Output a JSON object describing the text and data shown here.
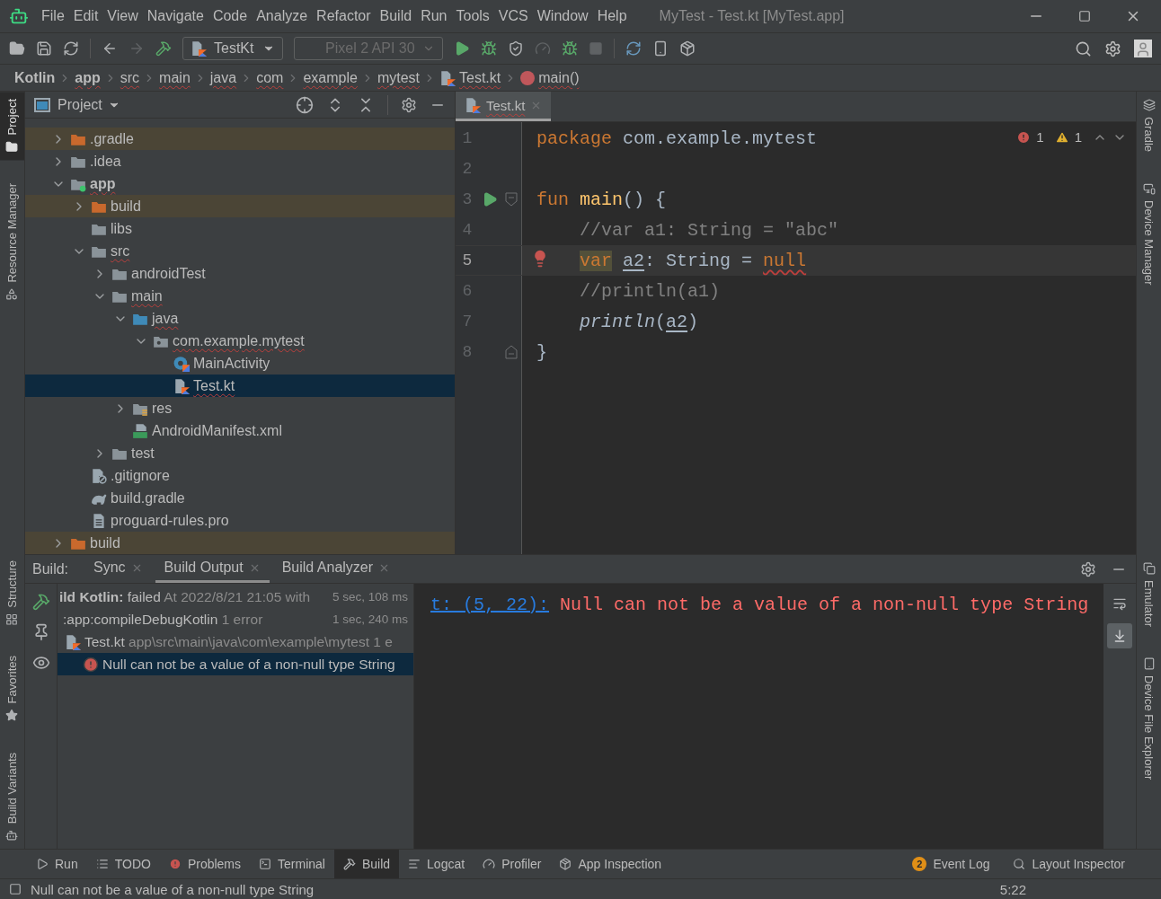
{
  "window": {
    "title": "MyTest - Test.kt [MyTest.app]"
  },
  "menu": [
    "File",
    "Edit",
    "View",
    "Navigate",
    "Code",
    "Analyze",
    "Refactor",
    "Build",
    "Run",
    "Tools",
    "VCS",
    "Window",
    "Help"
  ],
  "toolbar": {
    "run_config": "TestKt",
    "device": {
      "label": "Pixel 2 API 30",
      "disabled": true
    }
  },
  "breadcrumbs": [
    {
      "label": "Kotlin",
      "kind": "project",
      "error": false
    },
    {
      "label": "app",
      "kind": "module",
      "error": true
    },
    {
      "label": "src",
      "kind": "folder",
      "error": true
    },
    {
      "label": "main",
      "kind": "folder",
      "error": true
    },
    {
      "label": "java",
      "kind": "folder",
      "error": true
    },
    {
      "label": "com",
      "kind": "folder",
      "error": true
    },
    {
      "label": "example",
      "kind": "folder",
      "error": true
    },
    {
      "label": "mytest",
      "kind": "folder",
      "error": true
    },
    {
      "label": "Test.kt",
      "kind": "file",
      "error": true
    },
    {
      "label": "main()",
      "kind": "function",
      "error": true
    }
  ],
  "left_stripe": {
    "top": [
      {
        "label": "Project",
        "selected": true
      },
      {
        "label": "Resource Manager",
        "selected": false
      }
    ],
    "bottom": [
      {
        "label": "Structure",
        "selected": false
      },
      {
        "label": "Favorites",
        "selected": false
      },
      {
        "label": "Build Variants",
        "selected": false
      }
    ]
  },
  "right_stripe": {
    "top": [
      "Gradle",
      "Device Manager"
    ],
    "bottom": [
      "Emulator",
      "Device File Explorer"
    ]
  },
  "project_panel": {
    "title": "Project",
    "tree": [
      {
        "label": ".gradle",
        "kind": "folder-excluded",
        "expanded": false,
        "selected": false,
        "excluded": true,
        "error": false
      },
      {
        "label": ".idea",
        "kind": "folder",
        "expanded": false,
        "selected": false,
        "excluded": false,
        "error": false
      },
      {
        "label": "app",
        "kind": "module",
        "expanded": true,
        "selected": false,
        "excluded": false,
        "error": true,
        "children": [
          {
            "label": "build",
            "kind": "folder-excluded",
            "expanded": false,
            "selected": false,
            "excluded": true,
            "error": false
          },
          {
            "label": "libs",
            "kind": "folder",
            "selected": false,
            "excluded": false,
            "error": false
          },
          {
            "label": "src",
            "kind": "folder",
            "expanded": true,
            "selected": false,
            "excluded": false,
            "error": true,
            "children": [
              {
                "label": "androidTest",
                "kind": "folder",
                "expanded": false,
                "selected": false,
                "excluded": false,
                "error": false
              },
              {
                "label": "main",
                "kind": "folder",
                "expanded": true,
                "selected": false,
                "excluded": false,
                "error": true,
                "children": [
                  {
                    "label": "java",
                    "kind": "folder-source",
                    "expanded": true,
                    "selected": false,
                    "excluded": false,
                    "error": true,
                    "children": [
                      {
                        "label": "com.example.mytest",
                        "kind": "package",
                        "expanded": true,
                        "selected": false,
                        "excluded": false,
                        "error": true,
                        "children": [
                          {
                            "label": "MainActivity",
                            "kind": "activity",
                            "selected": false,
                            "excluded": false,
                            "error": false
                          },
                          {
                            "label": "Test.kt",
                            "kind": "kotlin-file",
                            "selected": true,
                            "excluded": false,
                            "error": true
                          }
                        ]
                      }
                    ]
                  },
                  {
                    "label": "res",
                    "kind": "res-folder",
                    "expanded": false,
                    "selected": false,
                    "excluded": false,
                    "error": false
                  },
                  {
                    "label": "AndroidManifest.xml",
                    "kind": "manifest",
                    "selected": false,
                    "excluded": false,
                    "error": false
                  }
                ]
              },
              {
                "label": "test",
                "kind": "folder",
                "expanded": false,
                "selected": false,
                "excluded": false,
                "error": false
              }
            ]
          },
          {
            "label": ".gitignore",
            "kind": "gitignore",
            "selected": false,
            "excluded": false,
            "error": false
          },
          {
            "label": "build.gradle",
            "kind": "gradle",
            "selected": false,
            "excluded": false,
            "error": false
          },
          {
            "label": "proguard-rules.pro",
            "kind": "text-file",
            "selected": false,
            "excluded": false,
            "error": false
          }
        ]
      },
      {
        "label": "build",
        "kind": "folder-excluded",
        "expanded": false,
        "selected": false,
        "excluded": true,
        "error": false
      }
    ]
  },
  "editor": {
    "tab": {
      "label": "Test.kt",
      "selected": true,
      "error": true
    },
    "errors": "1",
    "warnings": "1",
    "lines": [
      {
        "number": "1",
        "current": false,
        "indented": false,
        "runnable": false,
        "error": false,
        "fold_open": false,
        "fold_close": false,
        "tokens": [
          {
            "kind": "keyword",
            "text": "package"
          },
          {
            "kind": "plain",
            "text": " com.example.mytest"
          }
        ]
      },
      {
        "number": "2",
        "current": false,
        "runnable": false,
        "error": false,
        "fold_open": false,
        "fold_close": false
      },
      {
        "number": "3",
        "current": false,
        "indented": false,
        "runnable": true,
        "error": false,
        "fold_open": true,
        "fold_close": false,
        "tokens": [
          {
            "kind": "keyword",
            "text": "fun"
          },
          {
            "kind": "function",
            "text": " main"
          },
          {
            "kind": "plain",
            "text": "() {"
          }
        ]
      },
      {
        "number": "4",
        "current": false,
        "indented": true,
        "runnable": false,
        "error": false,
        "fold_open": false,
        "fold_close": false,
        "tokens": [
          {
            "kind": "comment",
            "text": "//var a1: String = \"abc\""
          }
        ]
      },
      {
        "number": "5",
        "current": true,
        "indented": true,
        "runnable": false,
        "error": true,
        "fold_open": false,
        "fold_close": false,
        "tokens": [
          {
            "kind": "marked-keyword",
            "text": "var"
          },
          {
            "kind": "ref",
            "text": " a2"
          },
          {
            "kind": "plain",
            "text": ": String = "
          },
          {
            "kind": "error-keyword",
            "text": "null"
          }
        ]
      },
      {
        "number": "6",
        "current": false,
        "indented": true,
        "runnable": false,
        "error": false,
        "fold_open": false,
        "fold_close": false,
        "tokens": [
          {
            "kind": "comment",
            "text": "//println(a1)"
          }
        ]
      },
      {
        "number": "7",
        "current": false,
        "indented": true,
        "runnable": false,
        "error": false,
        "fold_open": false,
        "fold_close": false,
        "tokens": [
          {
            "kind": "call",
            "text": "println"
          },
          {
            "kind": "plain",
            "text": "("
          },
          {
            "kind": "ref",
            "text": "a2"
          },
          {
            "kind": "plain",
            "text": ")"
          }
        ]
      },
      {
        "number": "8",
        "current": false,
        "indented": false,
        "runnable": false,
        "error": false,
        "fold_open": false,
        "fold_close": true,
        "tokens": [
          {
            "kind": "plain",
            "text": "}"
          }
        ]
      }
    ]
  },
  "build_panel": {
    "label": "Build:",
    "tabs": [
      {
        "label": "Sync",
        "selected": false
      },
      {
        "label": "Build Output",
        "selected": true
      },
      {
        "label": "Build Analyzer",
        "selected": false
      }
    ],
    "tree": [
      {
        "selected": false,
        "time": "5 sec, 108 ms",
        "segments": [
          {
            "kind": "bold",
            "text": "ild Kotlin:"
          },
          {
            "text": " failed "
          },
          {
            "kind": "muted",
            "text": "At 2022/8/21 21:05 with"
          }
        ],
        "children": [
          {
            "selected": false,
            "time": "1 sec, 240 ms",
            "segments": [
              {
                "text": ":app:compileDebugKotlin "
              },
              {
                "kind": "muted",
                "text": "1 error"
              }
            ],
            "children": [
              {
                "kind": "file",
                "selected": false,
                "segments": [
                  {
                    "text": "Test.kt "
                  },
                  {
                    "kind": "muted",
                    "text": "app\\src\\main\\java\\com\\example\\mytest 1 e"
                  }
                ],
                "children": [
                  {
                    "kind": "error",
                    "selected": true,
                    "segments": [
                      {
                        "text": "Null can not be a value of a non-null type String"
                      }
                    ]
                  }
                ]
              }
            ]
          }
        ]
      }
    ],
    "console": {
      "link": "t: (5, 22):",
      "message": "Null can not be a value of a non-null type String"
    }
  },
  "tool_tabs": [
    {
      "label": "Run",
      "selected": false
    },
    {
      "label": "TODO",
      "selected": false
    },
    {
      "label": "Problems",
      "selected": false
    },
    {
      "label": "Terminal",
      "selected": false
    },
    {
      "label": "Build",
      "selected": true
    },
    {
      "label": "Logcat",
      "selected": false
    },
    {
      "label": "Profiler",
      "selected": false
    },
    {
      "label": "App Inspection",
      "selected": false
    }
  ],
  "tool_tabs_right": {
    "event_log": {
      "label": "Event Log",
      "count": "2"
    },
    "layout_inspector": "Layout Inspector"
  },
  "status_bar": {
    "message": "Null can not be a value of a non-null type String",
    "position": "5:22"
  }
}
